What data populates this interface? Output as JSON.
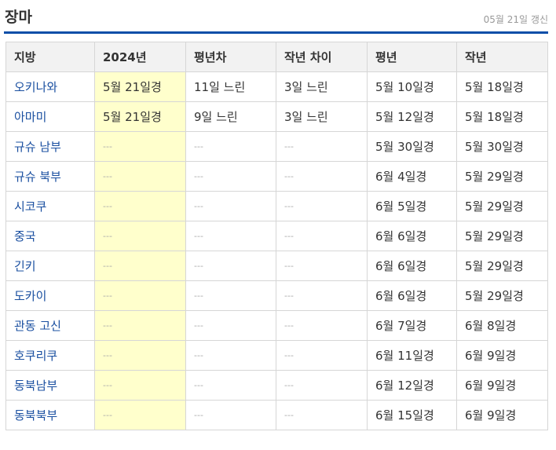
{
  "header": {
    "title": "장마",
    "updated": "05월 21일 갱신"
  },
  "columns": [
    "지방",
    "2024년",
    "평년차",
    "작년 차이",
    "평년",
    "작년"
  ],
  "rows": [
    [
      "오키나와",
      "5월 21일경",
      "11일 느린",
      "3일 느린",
      "5월 10일경",
      "5월 18일경"
    ],
    [
      "아마미",
      "5월 21일경",
      "9일 느린",
      "3일 느린",
      "5월 12일경",
      "5월 18일경"
    ],
    [
      "규슈 남부",
      "---",
      "---",
      "---",
      "5월 30일경",
      "5월 30일경"
    ],
    [
      "규슈 북부",
      "---",
      "---",
      "---",
      "6월 4일경",
      "5월 29일경"
    ],
    [
      "시코쿠",
      "---",
      "---",
      "---",
      "6월 5일경",
      "5월 29일경"
    ],
    [
      "중국",
      "---",
      "---",
      "---",
      "6월 6일경",
      "5월 29일경"
    ],
    [
      "긴키",
      "---",
      "---",
      "---",
      "6월 6일경",
      "5월 29일경"
    ],
    [
      "도카이",
      "---",
      "---",
      "---",
      "6월 6일경",
      "5월 29일경"
    ],
    [
      "관동 고신",
      "---",
      "---",
      "---",
      "6월 7일경",
      "6월 8일경"
    ],
    [
      "호쿠리쿠",
      "---",
      "---",
      "---",
      "6월 11일경",
      "6월 9일경"
    ],
    [
      "동북남부",
      "---",
      "---",
      "---",
      "6월 12일경",
      "6월 9일경"
    ],
    [
      "동북북부",
      "---",
      "---",
      "---",
      "6월 15일경",
      "6월 9일경"
    ]
  ],
  "colors": {
    "accent": "#0b4ea8",
    "highlight": "#ffffcc",
    "region_link": "#1a4fa0"
  }
}
